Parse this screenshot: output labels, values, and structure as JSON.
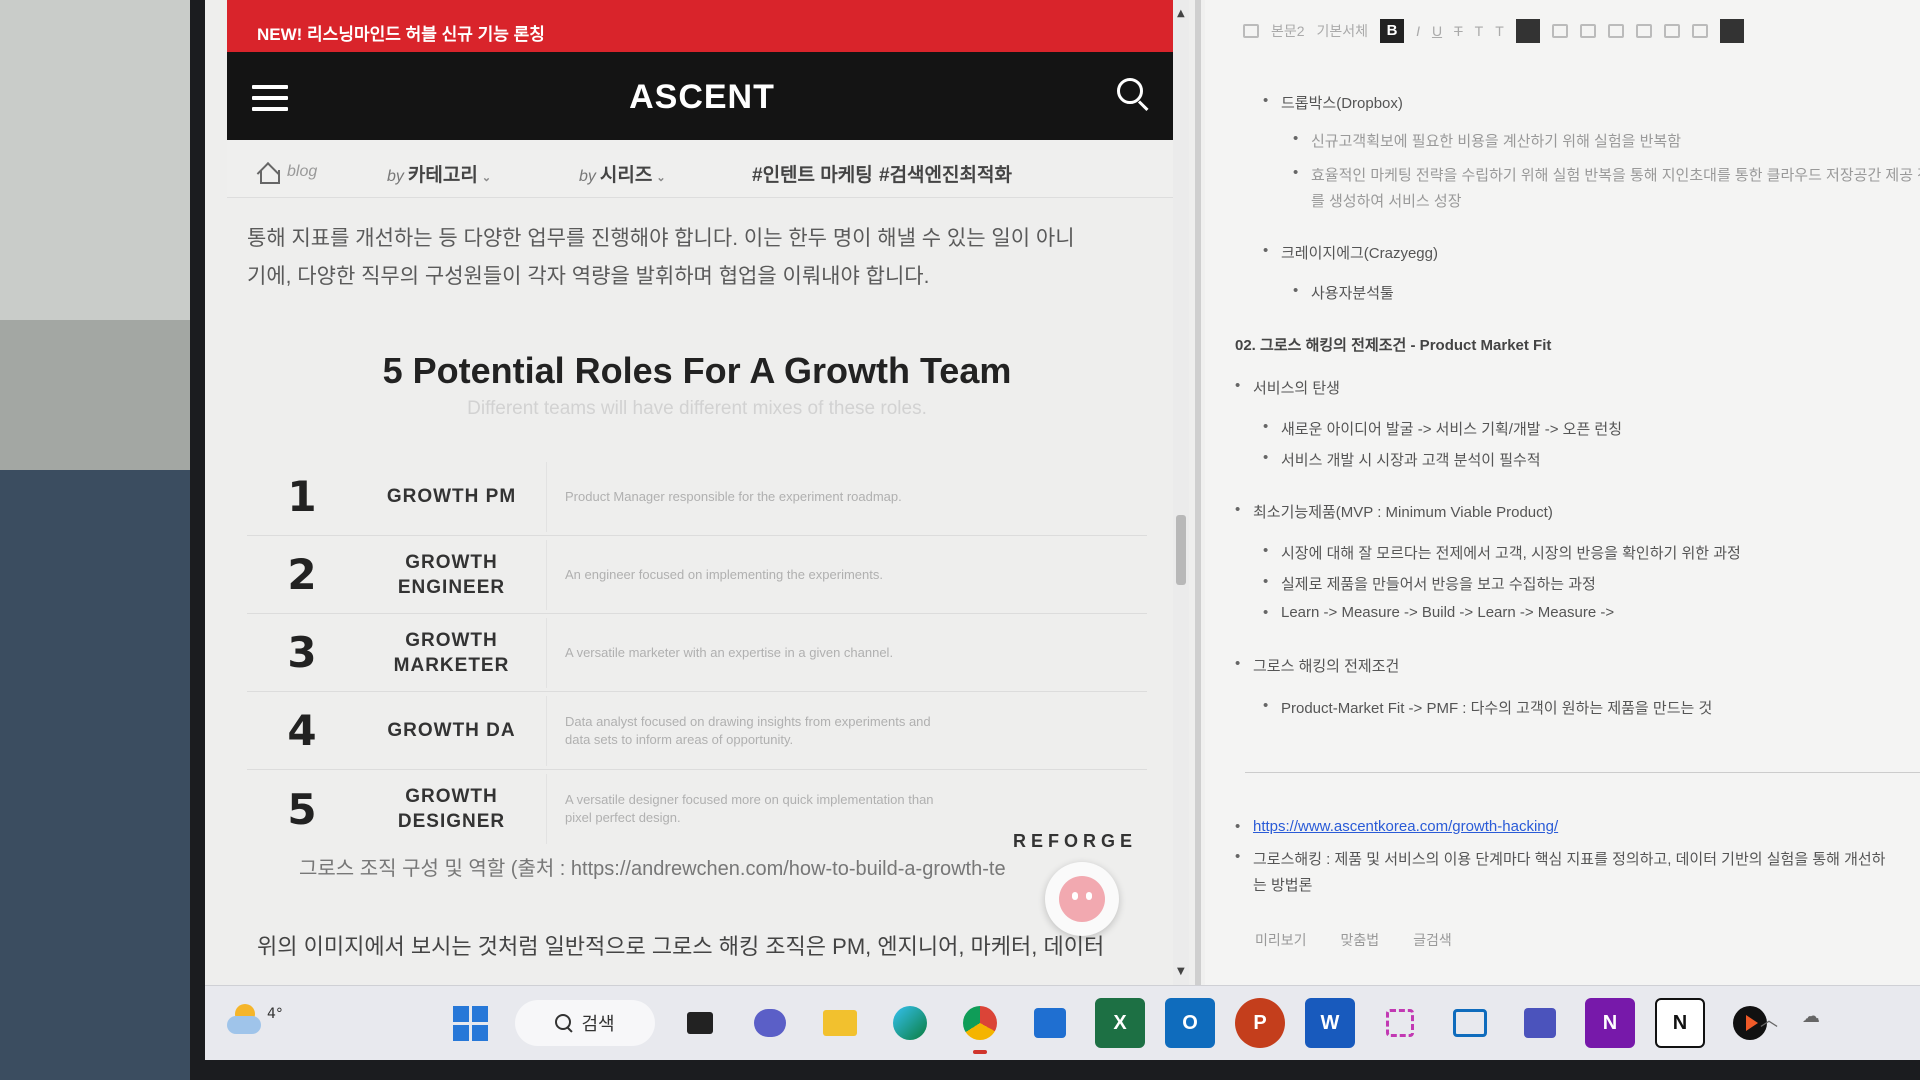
{
  "browser": {
    "promo_banner": "NEW! 리스닝마인드 허블 신규 기능 론칭",
    "site_logo": "ASCENT",
    "nav": {
      "home_label": "blog",
      "category_prefix": "by",
      "category_label": "카테고리",
      "series_prefix": "by",
      "series_label": "시리즈",
      "tag1": "#인텐트 마케팅",
      "tag2": "#검색엔진최적화"
    },
    "article": {
      "paragraph_top_line1": "통해 지표를 개선하는 등 다양한 업무를 진행해야 합니다. 이는 한두 명이 해낼 수 있는 일이 아니",
      "paragraph_top_line2": "기에, 다양한 직무의 구성원들이 각자 역량을 발휘하며 협업을 이뤄내야 합니다.",
      "figure": {
        "title": "5 Potential Roles For A Growth Team",
        "subtitle": "Different teams will have different mixes of these roles.",
        "roles": [
          {
            "num": "1",
            "name": "GROWTH PM",
            "desc": "Product Manager responsible for the experiment roadmap."
          },
          {
            "num": "2",
            "name": "GROWTH ENGINEER",
            "desc": "An engineer focused on implementing the experiments."
          },
          {
            "num": "3",
            "name": "GROWTH MARKETER",
            "desc": "A versatile marketer with an expertise in a given channel."
          },
          {
            "num": "4",
            "name": "GROWTH DA",
            "desc": "Data analyst focused on drawing insights from experiments and data sets to inform areas of opportunity."
          },
          {
            "num": "5",
            "name": "GROWTH DESIGNER",
            "desc": "A versatile designer focused more on quick implementation than pixel perfect design."
          }
        ],
        "brand": "REFORGE"
      },
      "caption": "그로스 조직 구성 및 역할 (출처 : https://andrewchen.com/how-to-build-a-growth-te",
      "paragraph_bottom": "위의 이미지에서 보시는 것처럼 일반적으로 그로스 해킹 조직은 PM, 엔지니어, 마케터, 데이터"
    }
  },
  "editor": {
    "toolbar": {
      "style_label": "본문2",
      "font_label": "기본서체",
      "bold_label": "B",
      "italic_label": "I",
      "underline_label": "U",
      "strike_label": "T",
      "color_label": "T",
      "clear_label": "T"
    },
    "outline": [
      {
        "text": "드롭박스(Dropbox)",
        "level": 2
      },
      {
        "text": "신규고객획보에 필요한 비용을 계산하기 위해 실험을 반복함",
        "level": 3
      },
      {
        "text": "효율적인 마케팅 전략을 수립하기 위해 실험 반복을 통해 지인초대를 통한 클라우드 저장공간 제공 전략",
        "level": 3
      },
      {
        "text": "를 생성하여 서비스 성장",
        "level": 3,
        "continuation": true
      },
      {
        "text": "크레이지에그(Crazyegg)",
        "level": 2
      },
      {
        "text": "사용자분석툴",
        "level": 3
      },
      {
        "text": "02. 그로스 해킹의 전제조건 - Product Market Fit",
        "level": 0,
        "heading": true
      },
      {
        "text": "서비스의 탄생",
        "level": 1
      },
      {
        "text": "새로운 아이디어 발굴 -> 서비스 기획/개발 -> 오픈 런칭",
        "level": 2
      },
      {
        "text": "서비스 개발 시 시장과 고객 분석이 필수적",
        "level": 2
      },
      {
        "text": "최소기능제품(MVP : Minimum Viable Product)",
        "level": 1
      },
      {
        "text": "시장에 대해 잘 모르다는 전제에서 고객, 시장의 반응을 확인하기 위한 과정",
        "level": 2
      },
      {
        "text": "실제로 제품을 만들어서 반응을 보고 수집하는 과정",
        "level": 2
      },
      {
        "text": "Learn -> Measure -> Build -> Learn -> Measure ->",
        "level": 2
      },
      {
        "text": "그로스 해킹의 전제조건",
        "level": 1
      },
      {
        "text": "Product-Market Fit -> PMF : 다수의 고객이 원하는 제품을 만드는 것",
        "level": 2
      },
      {
        "text": "https://www.ascentkorea.com/growth-hacking/",
        "level": 1,
        "link": true
      },
      {
        "text": "그로스해킹 : 제품 및 서비스의 이용 단계마다 핵심 지표를 정의하고, 데이터 기반의 실험을 통해 개선하",
        "level": 1
      },
      {
        "text": "는 방법론",
        "level": 1,
        "continuation": true
      }
    ],
    "footer": {
      "preview": "미리보기",
      "spellcheck": "맞춤법",
      "search": "글검색"
    }
  },
  "taskbar": {
    "weather_temp": "4°",
    "search_label": "검색",
    "apps": [
      "start-icon",
      "search-pill",
      "task-view-icon",
      "teams-meet-icon",
      "file-explorer-icon",
      "edge-icon",
      "chrome-icon",
      "store-icon",
      "excel-icon",
      "outlook-icon",
      "powerpoint-icon",
      "word-icon",
      "snipping-tool-icon",
      "reader-icon",
      "teams-icon",
      "onenote-icon",
      "notion-icon",
      "media-player-icon"
    ],
    "active_app": "chrome-icon",
    "app_labels": {
      "excel": "X",
      "outlook": "O",
      "powerpoint": "P",
      "word": "W",
      "onenote": "N",
      "notion": "N"
    }
  }
}
